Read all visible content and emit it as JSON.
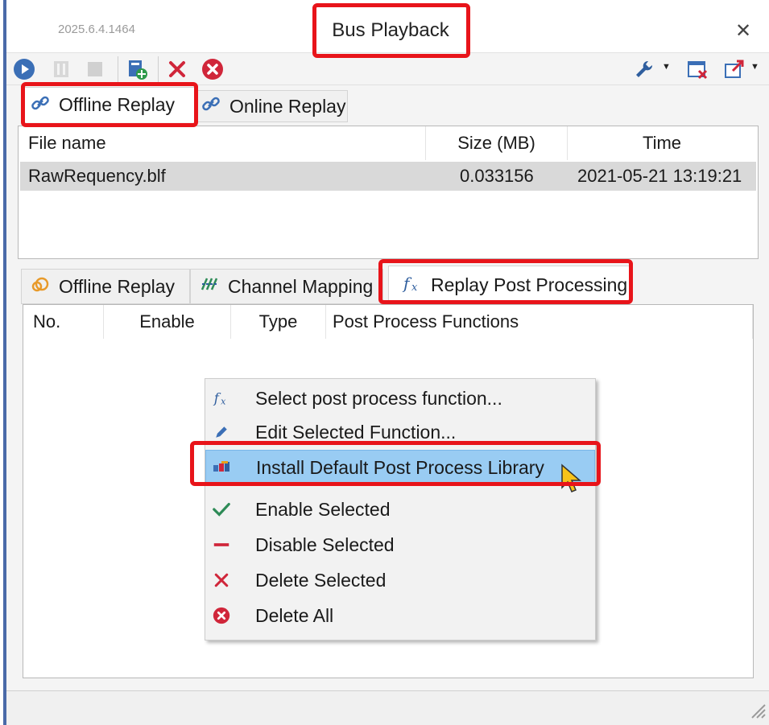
{
  "window": {
    "version": "2025.6.4.1464",
    "title": "Bus Playback",
    "close_glyph": "✕"
  },
  "toolbar": {
    "icons": [
      "play-icon",
      "pause-icon",
      "stop-icon",
      "add-file-icon",
      "remove-icon",
      "delete-all-icon",
      "wrench-icon",
      "close-window-icon",
      "export-icon"
    ],
    "dropdown_caret": "▼"
  },
  "top_tabs": [
    {
      "label": "Offline Replay",
      "icon": "link-icon",
      "active": true
    },
    {
      "label": "Online Replay",
      "icon": "link-icon",
      "active": false
    }
  ],
  "file_table": {
    "columns": [
      "File name",
      "Size (MB)",
      "Time"
    ],
    "rows": [
      {
        "name": "RawRequency.blf",
        "size": "0.033156",
        "time": "2021-05-21 13:19:21"
      }
    ]
  },
  "bottom_tabs": [
    {
      "label": "Offline Replay",
      "icon": "replay-icon",
      "active": false
    },
    {
      "label": "Channel Mapping",
      "icon": "mapping-icon",
      "active": false
    },
    {
      "label": "Replay Post Processing",
      "icon": "function-icon",
      "active": true
    }
  ],
  "post_table": {
    "columns": [
      "No.",
      "Enable",
      "Type",
      "Post Process Functions"
    ]
  },
  "context_menu": {
    "items": [
      {
        "label": "Select post process function...",
        "icon": "function-icon"
      },
      {
        "label": "Edit Selected Function...",
        "icon": "pencil-icon"
      },
      {
        "label": "Install Default Post Process Library",
        "icon": "library-icon",
        "highlighted": true
      },
      {
        "label": "Enable Selected",
        "icon": "check-icon"
      },
      {
        "label": "Disable Selected",
        "icon": "minus-icon"
      },
      {
        "label": "Delete Selected",
        "icon": "x-icon"
      },
      {
        "label": "Delete All",
        "icon": "delete-all-icon"
      }
    ]
  },
  "colors": {
    "annotation": "#e8141a",
    "menu_highlight": "#99ccf3",
    "selected_row": "#d9d9d9",
    "accent_blue": "#3b6fb6",
    "delete_red": "#d0263a",
    "enable_green": "#2e8b57"
  }
}
